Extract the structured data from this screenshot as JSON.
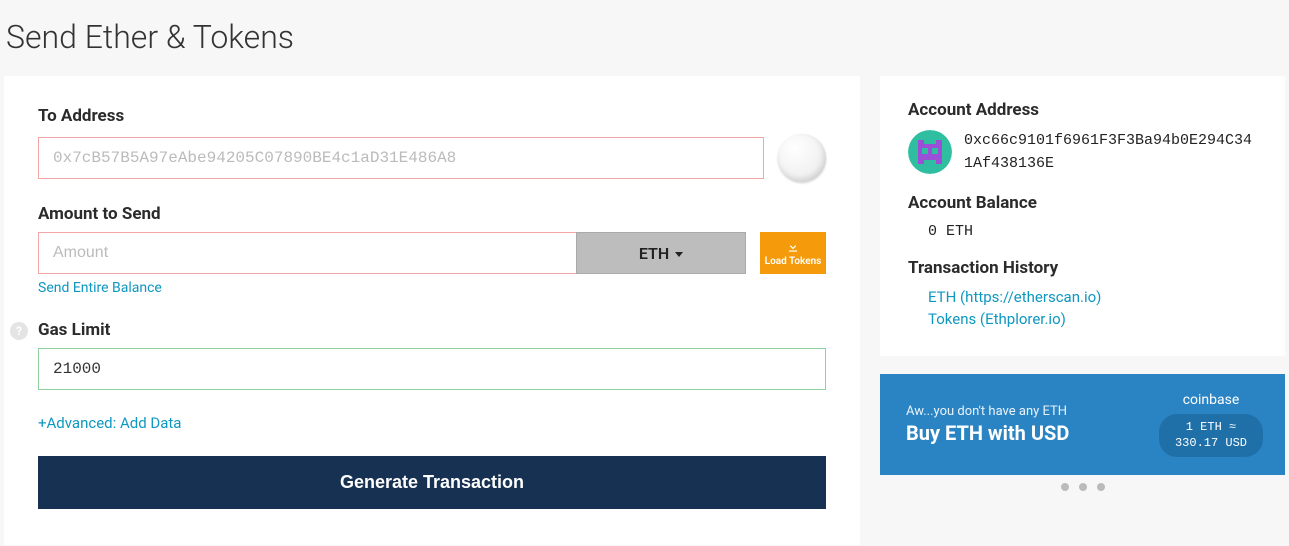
{
  "page_title": "Send Ether & Tokens",
  "form": {
    "to_label": "To Address",
    "to_placeholder": "0x7cB57B5A97eAbe94205C07890BE4c1aD31E486A8",
    "amount_label": "Amount to Send",
    "amount_placeholder": "Amount",
    "currency": "ETH",
    "load_tokens": "Load Tokens",
    "send_entire": "Send Entire Balance",
    "gas_label": "Gas Limit",
    "gas_value": "21000",
    "advanced": "+Advanced: Add Data",
    "generate": "Generate Transaction"
  },
  "account": {
    "address_heading": "Account Address",
    "address": "0xc66c9101f6961F3F3Ba94b0E294C341Af438136E",
    "balance_heading": "Account Balance",
    "balance": "0 ETH",
    "history_heading": "Transaction History",
    "history_eth": "ETH (https://etherscan.io)",
    "history_tokens": "Tokens (Ethplorer.io)"
  },
  "banner": {
    "sub": "Aw...you don't have any ETH",
    "main": "Buy ETH with USD",
    "provider": "coinbase",
    "rate_line1": "1 ETH ≈",
    "rate_line2": "330.17 USD"
  }
}
